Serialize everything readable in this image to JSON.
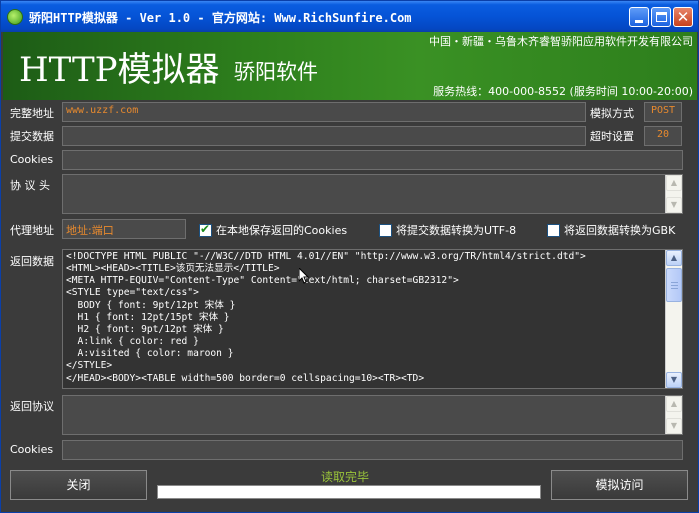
{
  "window": {
    "title": "骄阳HTTP模拟器 - Ver 1.0 - 官方网站: Www.RichSunfire.Com"
  },
  "banner": {
    "app_name": "HTTP模拟器",
    "brand": "骄阳软件",
    "company": "中国・新疆・乌鲁木齐睿智骄阳应用软件开发有限公司",
    "hotline": "服务热线：400-000-8552 (服务时间 10:00-20:00)"
  },
  "form": {
    "url_label": "完整地址",
    "url_value": "www.uzzf.com",
    "method_label": "模拟方式",
    "method_value": "POST",
    "post_label": "提交数据",
    "post_value": "",
    "timeout_label": "超时设置",
    "timeout_value": "20",
    "cookies_label": "Cookies",
    "cookies_value": "",
    "headers_label": "协 议 头",
    "proxy_label": "代理地址",
    "proxy_value": "地址:端口",
    "check_save_local": "在本地保存返回的Cookies",
    "check_submit_utf8": "将提交数据转换为UTF-8",
    "check_return_gbk": "将返回数据转换为GBK",
    "check_save_local_checked": true,
    "check_submit_utf8_checked": false,
    "check_return_gbk_checked": false
  },
  "response": {
    "data_label": "返回数据",
    "lines": [
      "<!DOCTYPE HTML PUBLIC \"-//W3C//DTD HTML 4.01//EN\" \"http://www.w3.org/TR/html4/strict.dtd\">",
      "<HTML><HEAD><TITLE>该页无法显示</TITLE>",
      "<META HTTP-EQUIV=\"Content-Type\" Content=\"text/html; charset=GB2312\">",
      "<STYLE type=\"text/css\">",
      "  BODY { font: 9pt/12pt 宋体 }",
      "  H1 { font: 12pt/15pt 宋体 }",
      "  H2 { font: 9pt/12pt 宋体 }",
      "  A:link { color: red }",
      "  A:visited { color: maroon }",
      "</STYLE>",
      "</HEAD><BODY><TABLE width=500 border=0 cellspacing=10><TR><TD>"
    ],
    "protocol_label": "返回协议",
    "cookies_label": "Cookies",
    "cookies_value": ""
  },
  "footer": {
    "close_label": "关闭",
    "status_text": "读取完毕",
    "simulate_label": "模拟访问"
  },
  "colors": {
    "banner_green": "#2d7e1c",
    "panel": "#3b3b3b",
    "value_orange": "#e88a2e",
    "status_green": "#9ac43a",
    "titlebar_blue": "#0553d6"
  }
}
